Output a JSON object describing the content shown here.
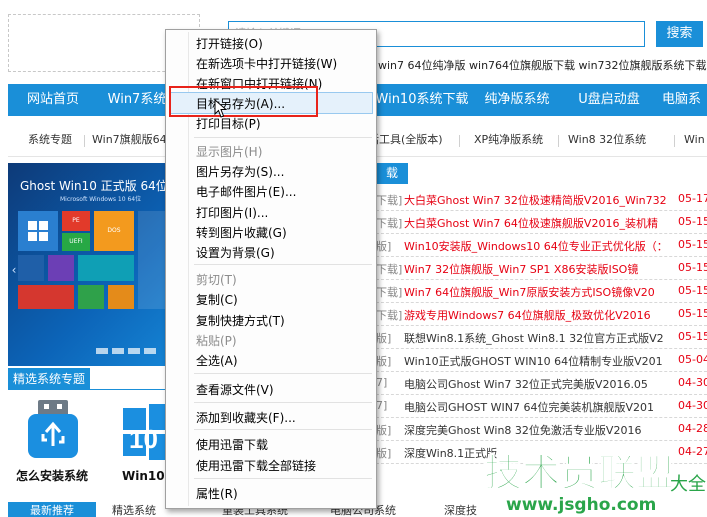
{
  "header": {
    "search_placeholder": "请输入关键词",
    "search_button": "搜索",
    "hot_links": "win7 64位纯净版 win764位旗舰版下载 win732位旗舰版系统下载"
  },
  "nav": {
    "items": [
      "网站首页",
      "Win7系统",
      "Win10系统下载",
      "纯净版系统",
      "U盘启动盘",
      "电脑系"
    ]
  },
  "subnav": {
    "items": [
      "系统专题",
      "Win7旗舰版64(",
      "活工具(全版本)",
      "XP纯净版系统",
      "Win8 32位系统",
      "Win"
    ]
  },
  "banner": {
    "title": "Ghost Win10 正式版 64位",
    "subtitle": "Microsoft Windows 10 64位",
    "tiles": [
      "PE",
      "UEFI",
      "DOS"
    ]
  },
  "featured": {
    "title": "精选系统专题",
    "item1": "怎么安装系统",
    "item2": "Win10系"
  },
  "articles": {
    "header_tab": "载",
    "rows": [
      {
        "cat": "下载]",
        "title": "大白菜Ghost Win7 32位极速精简版V2016_Win732",
        "date": "05-17",
        "color": "#e60012"
      },
      {
        "cat": "下载]",
        "title": "大白菜Ghost Win7 64位极速旗舰版V2016_装机精",
        "date": "05-15",
        "color": "#e60012"
      },
      {
        "cat": "版]",
        "title": "Win10安装版_Windows10 64位专业正式优化版（：",
        "date": "05-15",
        "color": "#e60012"
      },
      {
        "cat": "下载]",
        "title": "Win7 32位旗舰版_Win7 SP1 X86安装版ISO镜",
        "date": "05-15",
        "color": "#e60012"
      },
      {
        "cat": "下载]",
        "title": "Win7 64位旗舰版_Win7原版安装方式ISO镜像V20",
        "date": "05-15",
        "color": "#e60012"
      },
      {
        "cat": "下载]",
        "title": "游戏专用Windows7 64位旗舰版_极致优化V2016",
        "date": "05-15",
        "color": "#e60012"
      },
      {
        "cat": "版]",
        "title": "联想Win8.1系统_Ghost Win8.1 32位官方正式版V2",
        "date": "05-15",
        "color": "#333333"
      },
      {
        "cat": "版]",
        "title": "Win10正式版GHOST WIN10 64位精制专业版V201",
        "date": "05-04",
        "color": "#333333"
      },
      {
        "cat": "7]",
        "title": "电脑公司Ghost Win7 32位正式完美版V2016.05",
        "date": "04-30",
        "color": "#333333"
      },
      {
        "cat": "7]",
        "title": "电脑公司GHOST WIN7 64位完美装机旗舰版V201",
        "date": "04-30",
        "color": "#333333"
      },
      {
        "cat": "版]",
        "title": "深度完美Ghost Win8 32位免激活专业版V2016",
        "date": "04-28",
        "color": "#333333"
      },
      {
        "cat": "版]",
        "title": "深度Win8.1正式版",
        "date": "04-27",
        "color": "#333333"
      }
    ]
  },
  "bottom_tabs": [
    "最新推荐",
    "精选系统",
    "重装工具系统",
    "电脑公司系统",
    "深度技"
  ],
  "watermark": {
    "title": "技术员联盟",
    "url": "www.jsgho.com",
    "suffix": "大全"
  },
  "context_menu": {
    "items": [
      {
        "label": "打开链接(O)",
        "disabled": false
      },
      {
        "label": "在新选项卡中打开链接(W)",
        "disabled": false
      },
      {
        "label": "在新窗口中打开链接(N)",
        "disabled": false
      },
      {
        "label": "目标另存为(A)...",
        "disabled": false
      },
      {
        "label": "打印目标(P)",
        "disabled": false
      },
      {
        "label": "显示图片(H)",
        "disabled": true
      },
      {
        "label": "图片另存为(S)...",
        "disabled": false
      },
      {
        "label": "电子邮件图片(E)...",
        "disabled": false
      },
      {
        "label": "打印图片(I)...",
        "disabled": false
      },
      {
        "label": "转到图片收藏(G)",
        "disabled": false
      },
      {
        "label": "设置为背景(G)",
        "disabled": false
      },
      {
        "label": "剪切(T)",
        "disabled": true
      },
      {
        "label": "复制(C)",
        "disabled": false
      },
      {
        "label": "复制快捷方式(T)",
        "disabled": false
      },
      {
        "label": "粘贴(P)",
        "disabled": true
      },
      {
        "label": "全选(A)",
        "disabled": false
      },
      {
        "label": "查看源文件(V)",
        "disabled": false
      },
      {
        "label": "添加到收藏夹(F)...",
        "disabled": false
      },
      {
        "label": "使用迅雷下载",
        "disabled": false
      },
      {
        "label": "使用迅雷下载全部链接",
        "disabled": false
      },
      {
        "label": "属性(R)",
        "disabled": false
      }
    ]
  },
  "colors": {
    "accent": "#1a8fd8",
    "highlight_box": "#e8231a",
    "date_red": "#e60012",
    "watermark_green": "#2aa54a"
  }
}
